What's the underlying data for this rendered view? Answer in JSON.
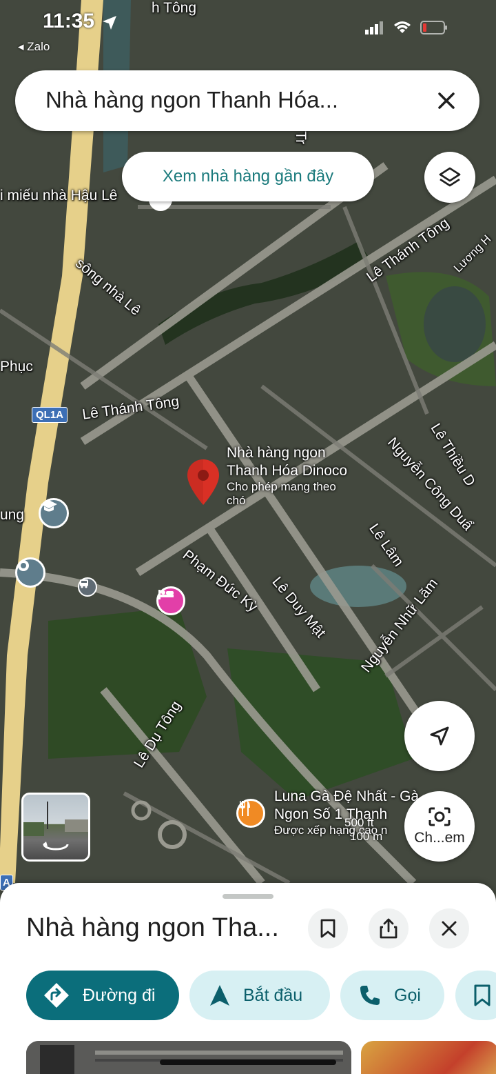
{
  "status_bar": {
    "time": "11:35",
    "back_app": "Zalo"
  },
  "search": {
    "query": "Nhà hàng ngon Thanh Hóa..."
  },
  "chip": {
    "label": "Xem nhà hàng gần đây"
  },
  "map": {
    "streets": [
      "Lê Thánh Tông",
      "Lê Thánh Tông",
      "Lương H",
      "Phạm Đức Kỳ",
      "Lê Duy Mật",
      "Nguyễn Nhữ Lãm",
      "Lê Lâm",
      "Nguyễn Công Duẩ",
      "Lê Thiều D",
      "Lê Dụ Tông",
      "sông nhà Lê",
      "Phục",
      "ung",
      "Tr",
      "h Tông",
      "i miếu nhà Hậu Lê"
    ],
    "highway_badge": "QL1A",
    "highway_badge_2": "A",
    "selected_place": {
      "name_line1": "Nhà hàng ngon",
      "name_line2": "Thanh Hóa Dinoco",
      "note_line1": "Cho phép mang theo",
      "note_line2": "chó"
    },
    "other_place": {
      "name_line1": "Luna Gà Đệ Nhất - Gà",
      "name_line2": "Ngon Số 1 Thanh",
      "note": "Được xếp hạng cao n"
    },
    "scale": {
      "imperial": "500 ft",
      "metric": "100 m"
    },
    "camera_button_label": "Ch...em"
  },
  "sheet": {
    "title": "Nhà hàng ngon Tha...",
    "actions": [
      {
        "label": "Đường đi"
      },
      {
        "label": "Bắt đầu"
      },
      {
        "label": "Gọi"
      }
    ]
  },
  "colors": {
    "primary": "#0b6e7b",
    "secondary_bg": "#d7f0f3",
    "pin": "#d93025",
    "chip_text": "#1a7a7c"
  }
}
